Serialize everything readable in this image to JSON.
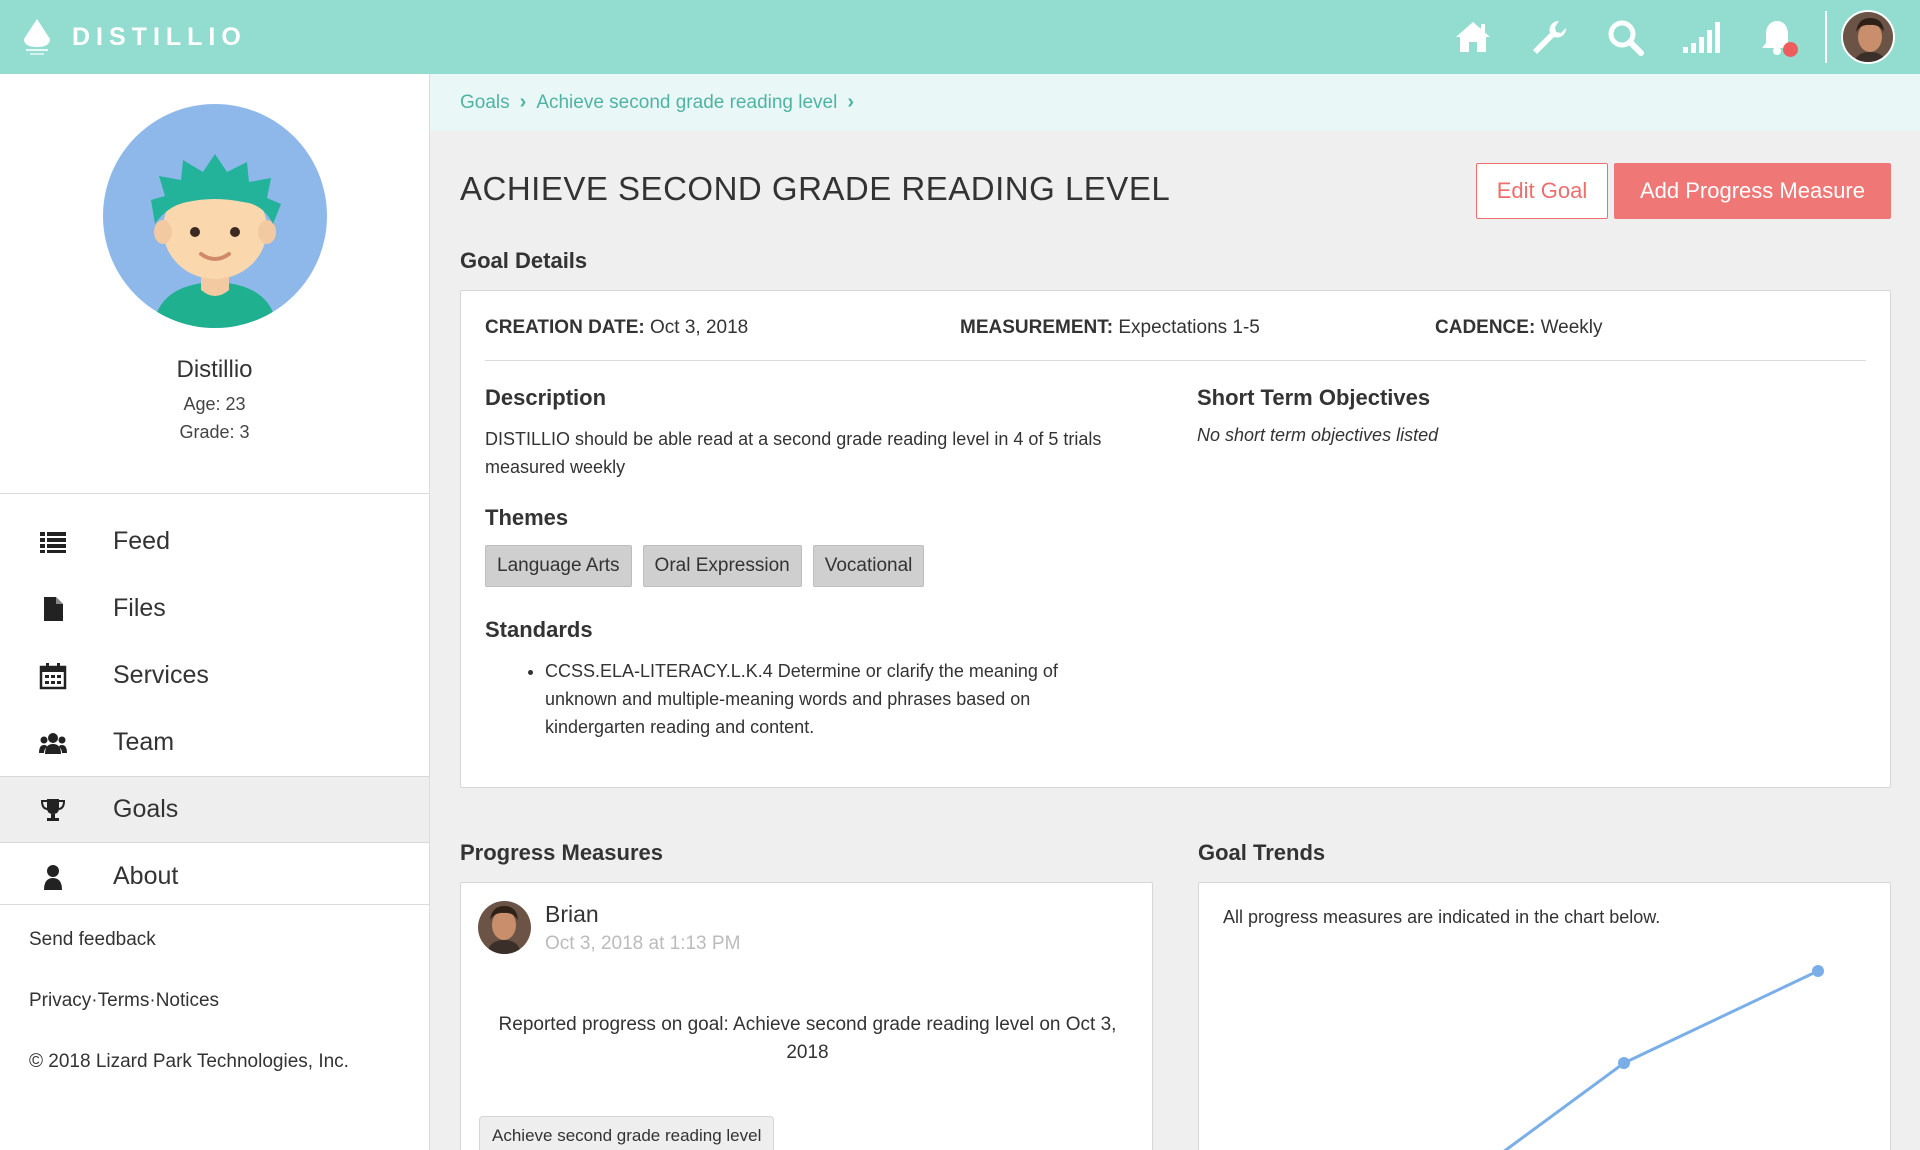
{
  "app": {
    "brand": "DISTILLIO"
  },
  "topbar": {
    "icons": [
      "home-icon",
      "wrench-icon",
      "search-icon",
      "signal-icon",
      "bell-icon"
    ],
    "notification_color": "#ee5d5d",
    "accent": "#93ddd0"
  },
  "profile": {
    "name": "Distillio",
    "age": "Age: 23",
    "grade": "Grade: 3"
  },
  "sidebar": {
    "items": [
      {
        "label": "Feed",
        "icon": "list-icon"
      },
      {
        "label": "Files",
        "icon": "file-icon"
      },
      {
        "label": "Services",
        "icon": "calendar-icon"
      },
      {
        "label": "Team",
        "icon": "users-icon"
      },
      {
        "label": "Goals",
        "icon": "trophy-icon",
        "active": true
      },
      {
        "label": "About",
        "icon": "user-icon"
      }
    ],
    "footer": {
      "feedback": "Send feedback",
      "privacy": "Privacy",
      "terms": "Terms",
      "notices": "Notices",
      "sep": "·",
      "copyright": "© 2018 Lizard Park Technologies, Inc."
    }
  },
  "breadcrumb": {
    "items": [
      "Goals",
      "Achieve second grade reading level"
    ]
  },
  "goal": {
    "title": "ACHIEVE SECOND GRADE READING LEVEL",
    "edit_label": "Edit Goal",
    "add_label": "Add Progress Measure",
    "details_heading": "Goal Details",
    "creation_label": "CREATION DATE:",
    "creation_value": "Oct 3, 2018",
    "measurement_label": "MEASUREMENT:",
    "measurement_value": "Expectations 1-5",
    "cadence_label": "CADENCE:",
    "cadence_value": "Weekly",
    "description_heading": "Description",
    "description": "DISTILLIO should be able read at a second grade reading level in 4 of 5 trials measured weekly",
    "sto_heading": "Short Term Objectives",
    "sto_text": "No short term objectives listed",
    "themes_heading": "Themes",
    "themes": [
      "Language Arts",
      "Oral Expression",
      "Vocational"
    ],
    "standards_heading": "Standards",
    "standards": [
      "CCSS.ELA-LITERACY.L.K.4 Determine or clarify the meaning of unknown and multiple-meaning words and phrases based on kindergarten reading and content."
    ]
  },
  "progress": {
    "heading": "Progress Measures",
    "author": "Brian",
    "time": "Oct 3, 2018 at 1:13 PM",
    "text": "Reported progress on goal: Achieve second grade reading level on Oct 3, 2018",
    "tag": "Achieve second grade reading level"
  },
  "trends": {
    "heading": "Goal Trends",
    "note": "All progress measures are indicated in the chart below."
  },
  "colors": {
    "primary_button": "#ef7876",
    "link": "#4fb3a3",
    "chart_line": "#7aaee8"
  }
}
